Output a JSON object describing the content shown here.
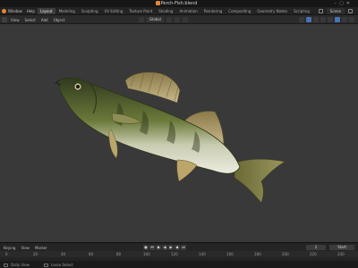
{
  "window": {
    "title": "Perch-Fish.blend"
  },
  "menubar": {
    "menus": [
      "Window",
      "Help"
    ],
    "workspaces": [
      "Layout",
      "Modeling",
      "Sculpting",
      "UV Editing",
      "Texture Paint",
      "Shading",
      "Animation",
      "Rendering",
      "Compositing",
      "Geometry Nodes",
      "Scripting"
    ],
    "active_workspace": "Layout",
    "scene": "Scene"
  },
  "viewport_header": {
    "menus": [
      "View",
      "Select",
      "Add",
      "Object"
    ],
    "orientation": "Global"
  },
  "timeline": {
    "menus": [
      "Keying",
      "View",
      "Marker"
    ],
    "current_frame": "1",
    "start_label": "Start",
    "ruler": [
      "0",
      "20",
      "40",
      "60",
      "80",
      "100",
      "120",
      "140",
      "160",
      "180",
      "200",
      "220",
      "240"
    ]
  },
  "statusbar": {
    "items": [
      "Dolly View",
      "Lasso Select"
    ]
  },
  "colors": {
    "accent": "#4772b3",
    "viewport_bg": "#393939",
    "logo": "#e3863a"
  }
}
